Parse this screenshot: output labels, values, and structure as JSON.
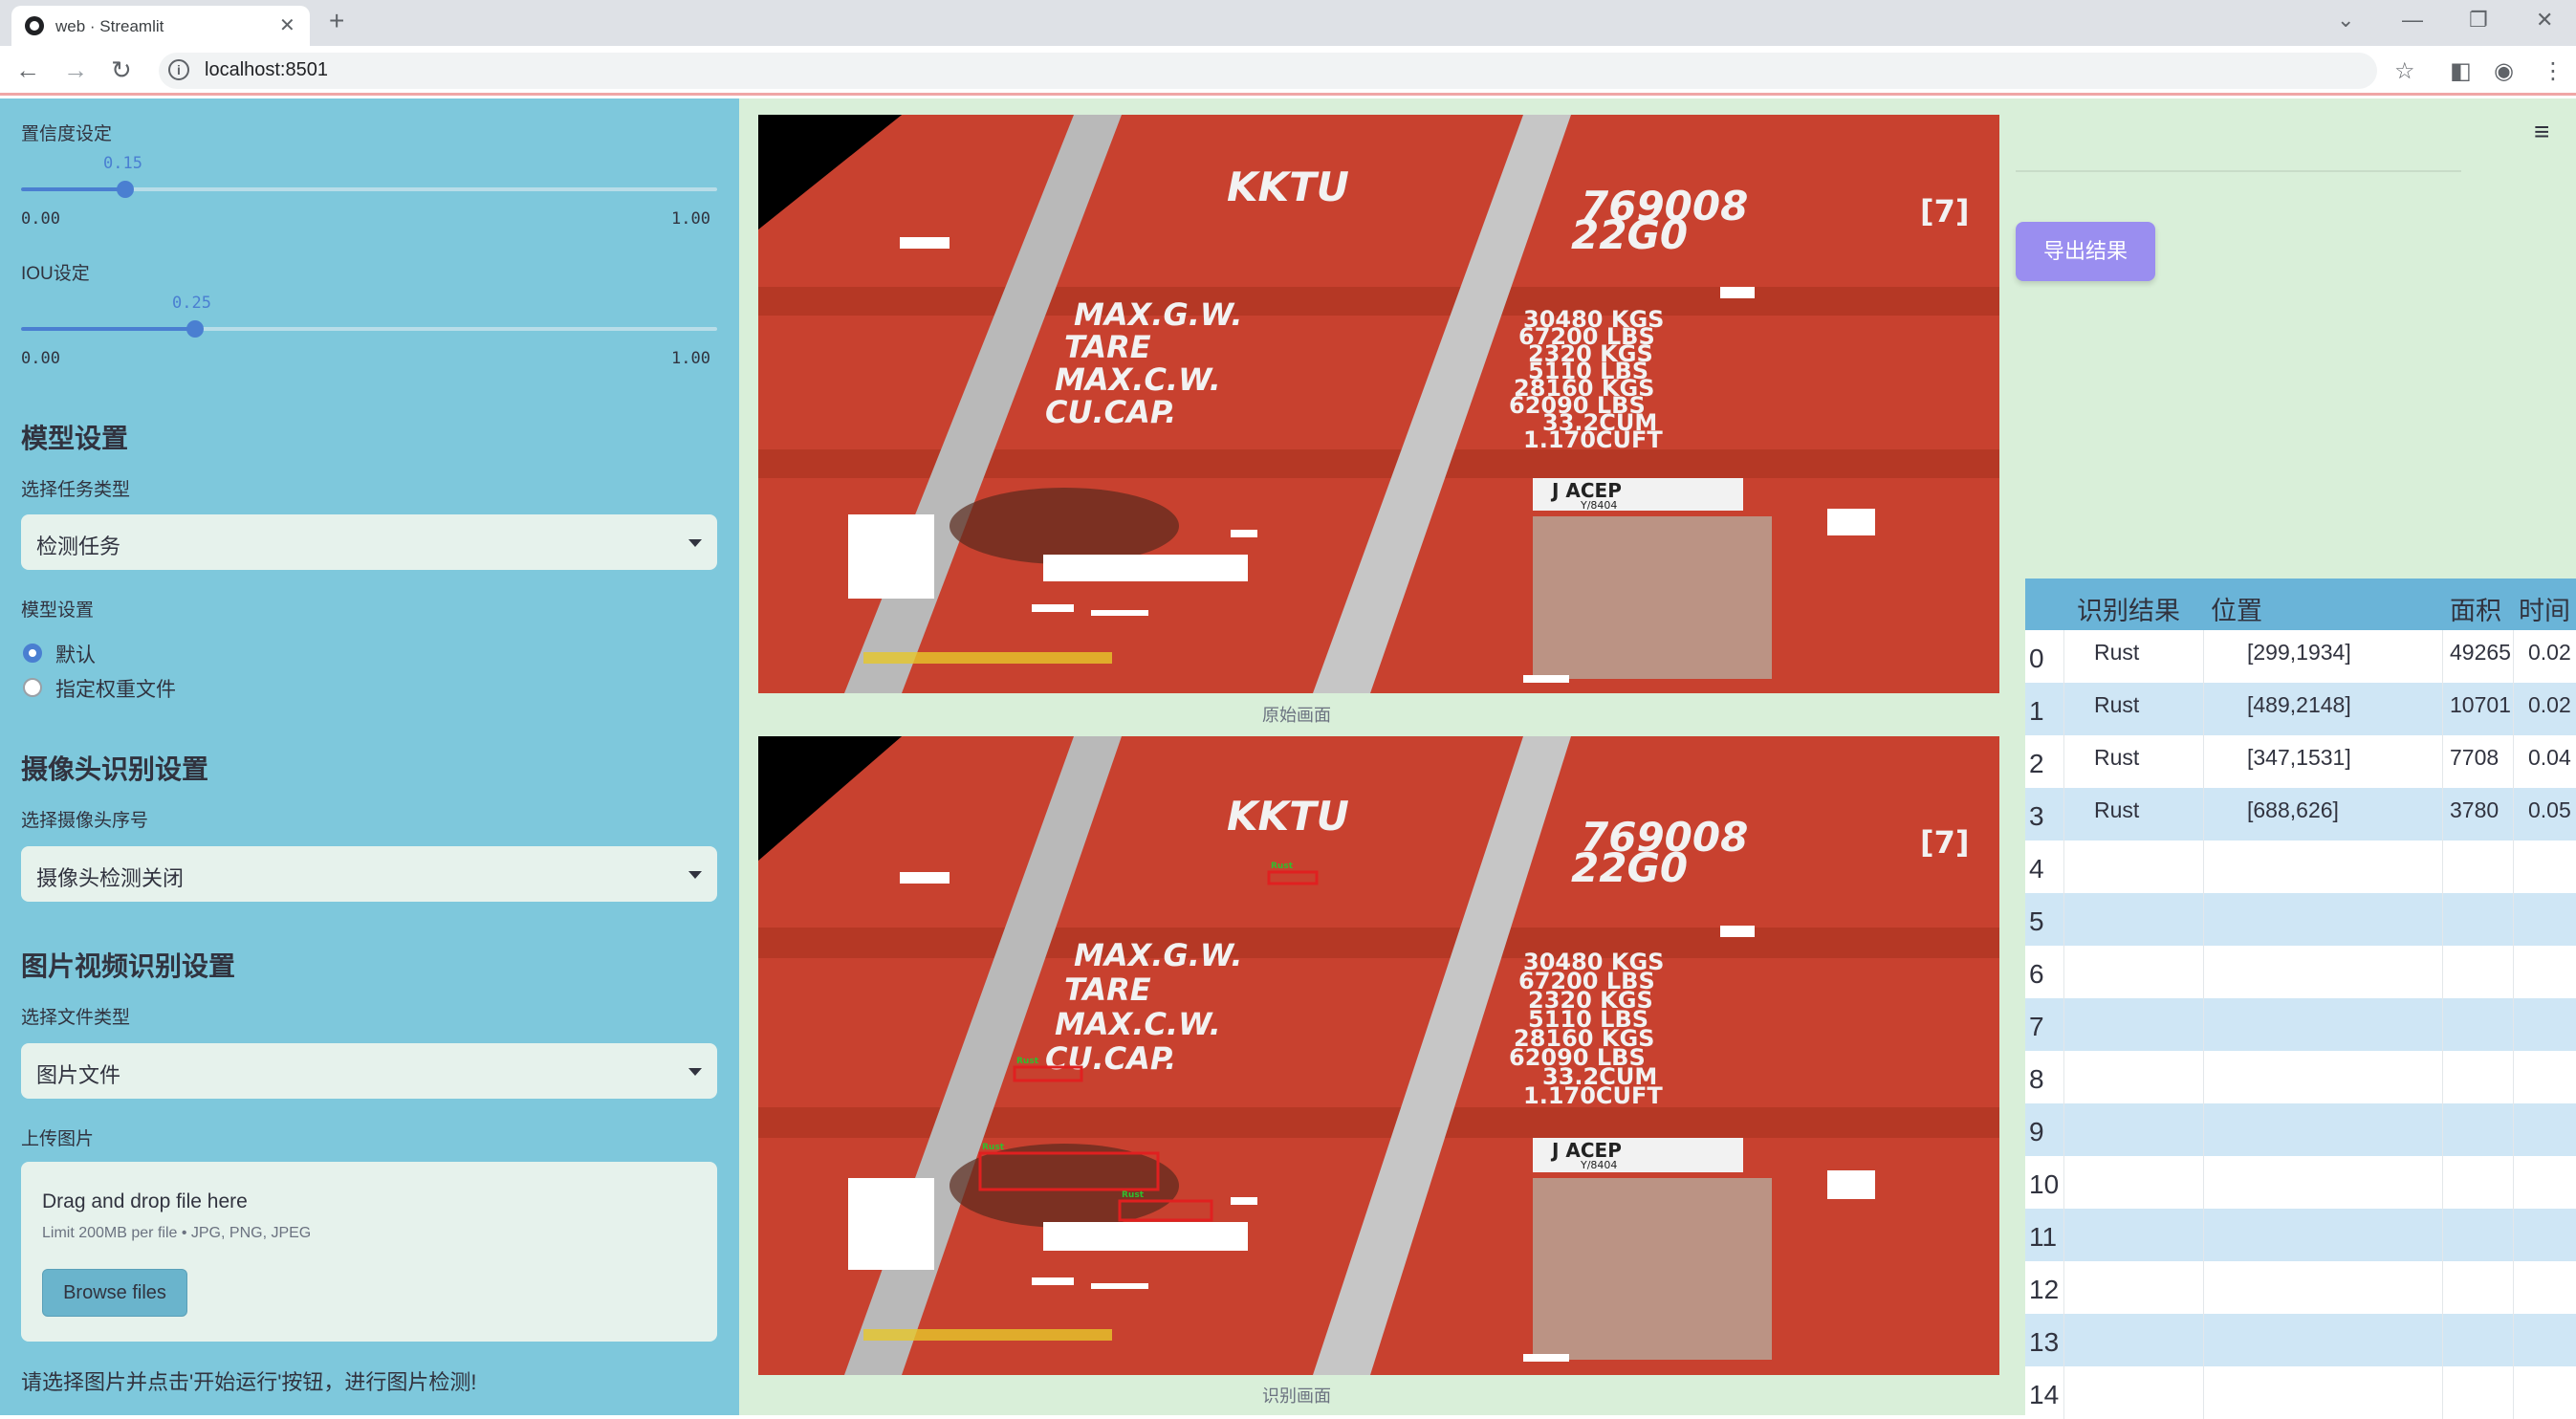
{
  "browser": {
    "tab_title": "web · Streamlit",
    "url": "localhost:8501",
    "icons": [
      "back-icon",
      "forward-icon",
      "reload-icon",
      "info-icon",
      "star-icon",
      "sidepanel-icon",
      "profile-icon",
      "kebab-icon"
    ]
  },
  "sidebar": {
    "confidence": {
      "label": "置信度设定",
      "value": "0.15",
      "min": "0.00",
      "max": "1.00",
      "fraction": 0.15
    },
    "iou": {
      "label": "IOU设定",
      "value": "0.25",
      "min": "0.00",
      "max": "1.00",
      "fraction": 0.25
    },
    "model_heading": "模型设置",
    "task_label": "选择任务类型",
    "task_value": "检测任务",
    "model_label": "模型设置",
    "radio_default": "默认",
    "radio_custom": "指定权重文件",
    "camera_heading": "摄像头识别设置",
    "camera_label": "选择摄像头序号",
    "camera_value": "摄像头检测关闭",
    "media_heading": "图片视频识别设置",
    "filetype_label": "选择文件类型",
    "filetype_value": "图片文件",
    "upload_label": "上传图片",
    "upload_title": "Drag and drop file here",
    "upload_limit": "Limit 200MB per file • JPG, PNG, JPEG",
    "browse_label": "Browse files",
    "hint": "请选择图片并点击'开始运行'按钮，进行图片检测!"
  },
  "main": {
    "caption_original": "原始画面",
    "caption_detect": "识别画面",
    "export_label": "导出结果",
    "image_text": {
      "code": "KKTU",
      "number": "769008",
      "check": "[7]",
      "type": "22G0",
      "left_labels": [
        "MAX.G.W.",
        "TARE",
        "MAX.C.W.",
        "CU.CAP."
      ],
      "right_labels": [
        "30480 KGS",
        "67200 LBS",
        "2320 KGS",
        "5110 LBS",
        "28160 KGS",
        "62090 LBS",
        "33.2CUM",
        "1.170CUFT"
      ],
      "plate": "J ACEP",
      "plate_sub": "Y/8404",
      "det_label": "Rust"
    }
  },
  "table": {
    "headers": [
      "识别结果",
      "位置",
      "面积",
      "时间"
    ],
    "rows": [
      {
        "idx": "0",
        "result": "Rust",
        "pos": "[299,1934]",
        "area": "49265",
        "time": "0.02"
      },
      {
        "idx": "1",
        "result": "Rust",
        "pos": "[489,2148]",
        "area": "10701",
        "time": "0.02"
      },
      {
        "idx": "2",
        "result": "Rust",
        "pos": "[347,1531]",
        "area": "7708",
        "time": "0.04"
      },
      {
        "idx": "3",
        "result": "Rust",
        "pos": "[688,626]",
        "area": "3780",
        "time": "0.05"
      },
      {
        "idx": "4"
      },
      {
        "idx": "5"
      },
      {
        "idx": "6"
      },
      {
        "idx": "7"
      },
      {
        "idx": "8"
      },
      {
        "idx": "9"
      },
      {
        "idx": "10"
      },
      {
        "idx": "11"
      },
      {
        "idx": "12"
      },
      {
        "idx": "13"
      },
      {
        "idx": "14"
      }
    ]
  },
  "colors": {
    "sidebar": "#7ec8dc",
    "main": "#d9efd9",
    "accent": "#4a7fd1",
    "export": "#9a8ef0",
    "container": "#c8412f"
  }
}
